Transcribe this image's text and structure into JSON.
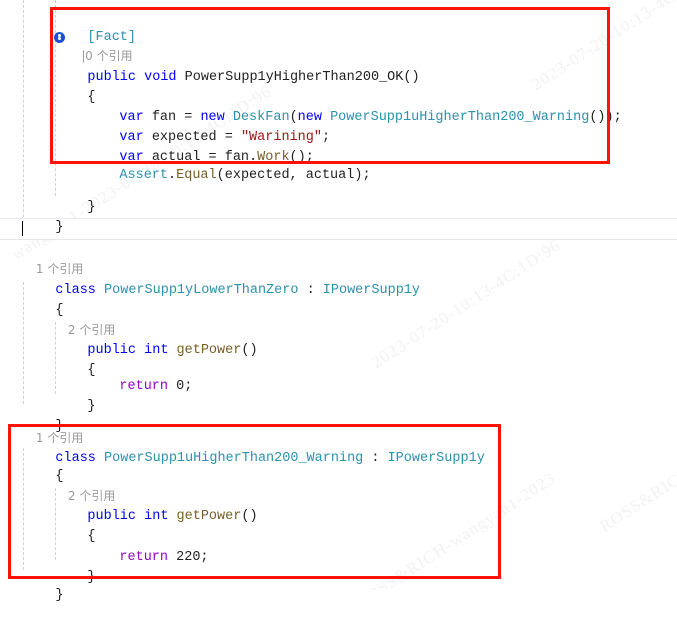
{
  "editor": {
    "language": "csharp",
    "background": "#ffffff",
    "accent_red": "#fe1200",
    "keyword_color": "#0000ff",
    "type_color": "#2b91af",
    "control_color": "#8f08c4",
    "method_color": "#795e26",
    "string_color": "#a31515",
    "codelens_color": "#9a9a9a"
  },
  "codelens": {
    "zero_refs": "0 个引用",
    "one_ref": "1 个引用",
    "two_refs": "2 个引用",
    "separator": "|",
    "test_icon": "test-status-icon"
  },
  "code": {
    "line_attr_fact": "[Fact]",
    "line_method_sig": {
      "kw_public": "public",
      "kw_void": "void",
      "name": "PowerSupp1yHigherThan200_OK",
      "parens": "()"
    },
    "brace_open": "{",
    "brace_close": "}",
    "line_var_fan": {
      "kw_var": "var",
      "name": " fan = ",
      "kw_new1": "new",
      "type1": " DeskFan",
      "p1": "(",
      "kw_new2": "new",
      "type2": " PowerSupp1uHigherThan200_Warning",
      "p2": "());"
    },
    "line_var_expected": {
      "kw_var": "var",
      "name": " expected = ",
      "str": "\"Warining\"",
      "semi": ";"
    },
    "line_var_actual": {
      "kw_var": "var",
      "name": " actual = fan.",
      "method": "Work",
      "tail": "();"
    },
    "line_assert": {
      "type": "Assert",
      "dot": ".",
      "method": "Equal",
      "args": "(expected, actual);"
    },
    "class_lower_than_zero": {
      "kw_class": "class",
      "name": " PowerSupp1yLowerThanZero",
      "colon": " : ",
      "iface": "IPowerSupp1y"
    },
    "class_higher_than_200": {
      "kw_class": "class",
      "name": " PowerSupp1uHigherThan200_Warning",
      "colon": " : ",
      "iface": "IPowerSupp1y"
    },
    "getpower_sig": {
      "kw_public": "public",
      "kw_int": " int",
      "name": " getPower",
      "parens": "()"
    },
    "return_zero": {
      "kw_return": "return",
      "value": " 0",
      "semi": ";"
    },
    "return_220": {
      "kw_return": "return",
      "value": " 220",
      "semi": ";"
    }
  },
  "annotations": {
    "box_test_method": "highlight-test-method",
    "box_warning_class": "highlight-warning-class"
  },
  "watermarks": [
    "2023-07-20-10:13-4C:1D:96",
    "2023-07-20-10:13-4C:1D:96",
    "wangyan1-2023-07-20-10:13-4C:1D:96",
    "ROSS&RICH-wangyan1",
    "ROSS&RICH-wangyan1-2023"
  ]
}
